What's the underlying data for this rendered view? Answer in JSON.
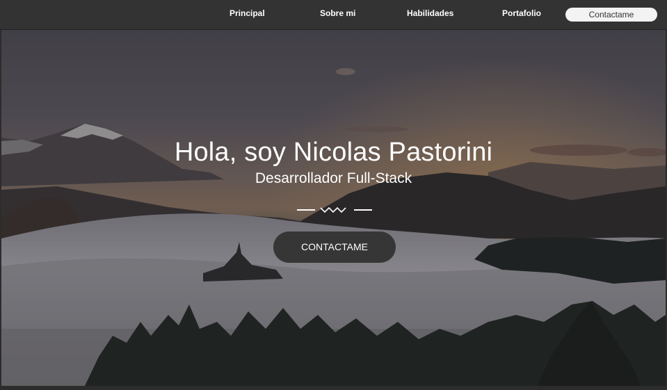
{
  "nav": {
    "items": [
      {
        "label": "Principal"
      },
      {
        "label": "Sobre mi"
      },
      {
        "label": "Habilidades"
      },
      {
        "label": "Portafolio"
      }
    ],
    "contact_label": "Contactame"
  },
  "hero": {
    "title": "Hola, soy Nicolas Pastorini",
    "subtitle": "Desarrollador Full-Stack",
    "cta_label": "CONTACTAME",
    "divider_icon": "zigzag-divider-icon",
    "background_icon": "misty-mountain-landscape"
  },
  "colors": {
    "navbar": "#333333",
    "cta_button": "#363636",
    "nav_contact_button": "#f3f3f3",
    "text": "#ffffff"
  }
}
